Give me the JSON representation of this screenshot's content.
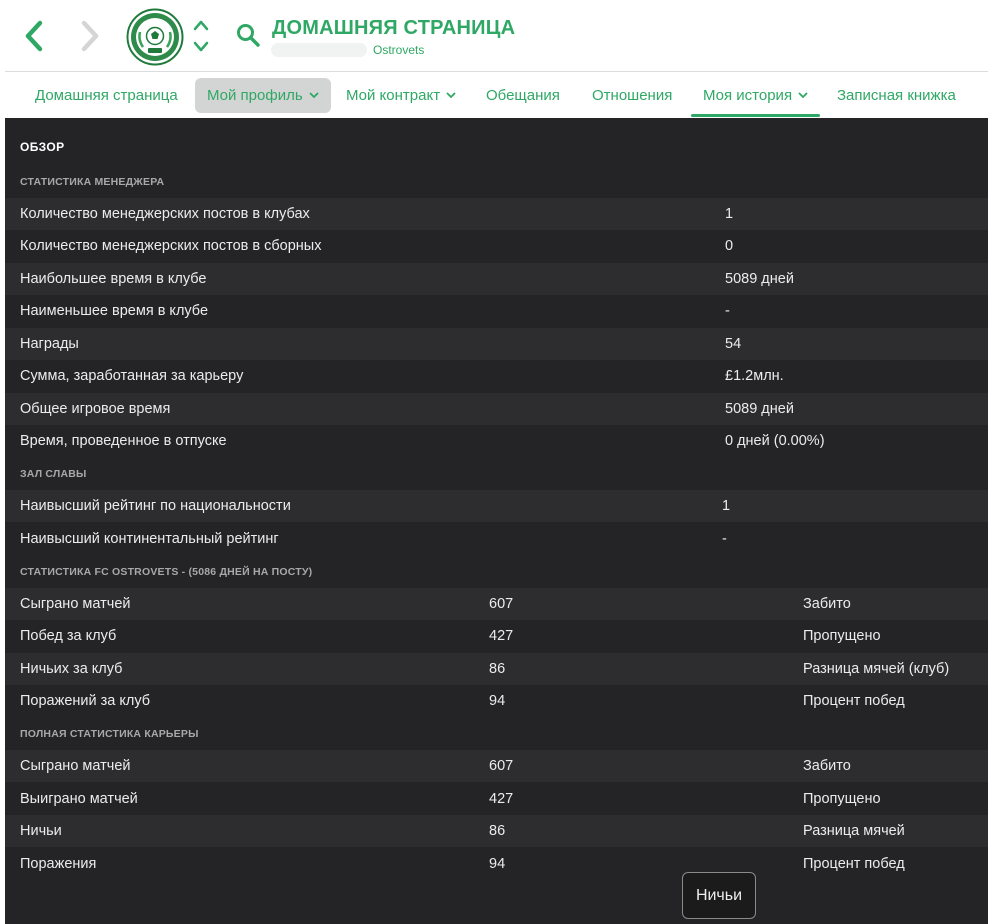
{
  "header": {
    "title": "ДОМАШНЯЯ СТРАНИЦА",
    "subtitle": "Ostrovets",
    "club_logo_icon": "club-crest-icon",
    "accent_color": "#2fa865"
  },
  "tabs": [
    {
      "label": "Домашняя страница"
    },
    {
      "label": "Мой профиль"
    },
    {
      "label": "Мой контракт"
    },
    {
      "label": "Обещания"
    },
    {
      "label": "Отношения"
    },
    {
      "label": "Моя история"
    },
    {
      "label": "Записная книжка"
    }
  ],
  "overview": {
    "title": "ОБЗОР",
    "manager_stats": {
      "title": "СТАТИСТИКА МЕНЕДЖЕРА",
      "rows": [
        {
          "label": "Количество менеджерских постов в клубах",
          "value": "1"
        },
        {
          "label": "Количество менеджерских постов в сборных",
          "value": "0"
        },
        {
          "label": "Наибольшее время в клубе",
          "value": "5089 дней"
        },
        {
          "label": "Наименьшее время в клубе",
          "value": "-"
        },
        {
          "label": "Награды",
          "value": "54"
        },
        {
          "label": "Сумма, заработанная за карьеру",
          "value": "£1.2млн."
        },
        {
          "label": "Общее игровое время",
          "value": "5089 дней"
        },
        {
          "label": "Время, проведенное в отпуске",
          "value": "0 дней (0.00%)"
        }
      ]
    },
    "hall_of_fame": {
      "title": "ЗАЛ СЛАВЫ",
      "rows": [
        {
          "label": "Наивысший рейтинг по национальности",
          "value": "1"
        },
        {
          "label": "Наивысший континентальный рейтинг",
          "value": "-"
        }
      ]
    },
    "club_stats": {
      "title": "СТАТИСТИКА FC OSTROVETS - (5086 ДНЕЙ НА ПОСТУ)",
      "rows": [
        {
          "label": "Сыграно матчей",
          "value": "607",
          "label2": "Забито"
        },
        {
          "label": "Побед за клуб",
          "value": "427",
          "label2": "Пропущено"
        },
        {
          "label": "Ничьих за клуб",
          "value": "86",
          "label2": "Разница мячей (клуб)"
        },
        {
          "label": "Поражений за клуб",
          "value": "94",
          "label2": "Процент побед"
        }
      ]
    },
    "career_stats": {
      "title": "ПОЛНАЯ СТАТИСТИКА КАРЬЕРЫ",
      "rows": [
        {
          "label": "Сыграно матчей",
          "value": "607",
          "label2": "Забито"
        },
        {
          "label": "Выиграно матчей",
          "value": "427",
          "label2": "Пропущено"
        },
        {
          "label": "Ничьи",
          "value": "86",
          "label2": "Разница мячей"
        },
        {
          "label": "Поражения",
          "value": "94",
          "label2": "Процент побед"
        }
      ]
    }
  },
  "tooltip": {
    "label": "Ничьи"
  }
}
